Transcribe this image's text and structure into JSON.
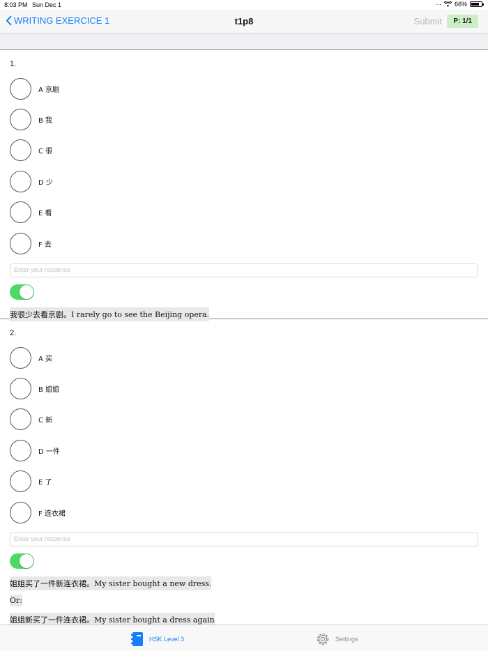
{
  "status": {
    "time": "8:03 PM",
    "date": "Sun Dec 1",
    "battery": "66%"
  },
  "nav": {
    "back_label": "WRITING EXERCICE 1",
    "title": "t1p8",
    "submit_label": "Submit",
    "page_badge": "P: 1/1"
  },
  "questions": [
    {
      "number": "1.",
      "options": [
        "A 京剧",
        "B 我",
        "C 很",
        "D 少",
        "E 看",
        "F 去"
      ],
      "response_placeholder": "Enter your response",
      "answer_lines": [
        "我很少去看京剧。I rarely go to see the Beijing opera."
      ]
    },
    {
      "number": "2.",
      "options": [
        "A 买",
        "B 姐姐",
        "C 新",
        "D 一件",
        "E 了",
        "F 连衣裙"
      ],
      "response_placeholder": "Enter your response",
      "answer_lines": [
        "姐姐买了一件新连衣裙。My sister bought a new dress.",
        "Or:",
        "姐姐新买了一件连衣裙。My sister bought a dress again"
      ]
    }
  ],
  "tabs": {
    "hsk_label": "HSK Level 3",
    "settings_label": "Settings"
  },
  "colors": {
    "accent": "#147efb",
    "toggle_on": "#4cd964",
    "badge_bg": "#cdeec7"
  }
}
